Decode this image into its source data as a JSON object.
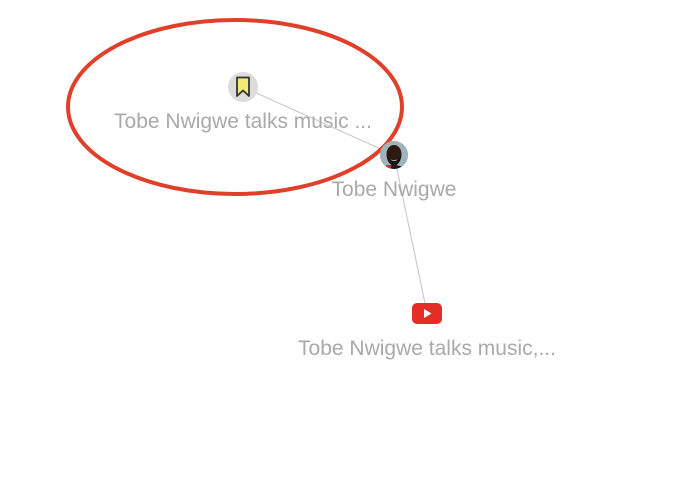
{
  "graph": {
    "colors": {
      "edge": "#c9c4bc",
      "label": "#a9a9a9",
      "highlight": "#e0402a",
      "bookmark_fill": "#f3e77a",
      "bookmark_stroke": "#333333",
      "bookmark_bg": "#dcdcdc",
      "video_red": "#e52d27"
    },
    "nodes": [
      {
        "id": "bookmark",
        "label": "Tobe Nwigwe talks music ...",
        "icon": "bookmark-icon",
        "highlighted": true
      },
      {
        "id": "person",
        "label": "Tobe Nwigwe",
        "icon": "avatar"
      },
      {
        "id": "video",
        "label": "Tobe Nwigwe talks music,...",
        "icon": "youtube-play-icon"
      }
    ],
    "edges": [
      {
        "from": "bookmark",
        "to": "person"
      },
      {
        "from": "person",
        "to": "video"
      }
    ]
  }
}
